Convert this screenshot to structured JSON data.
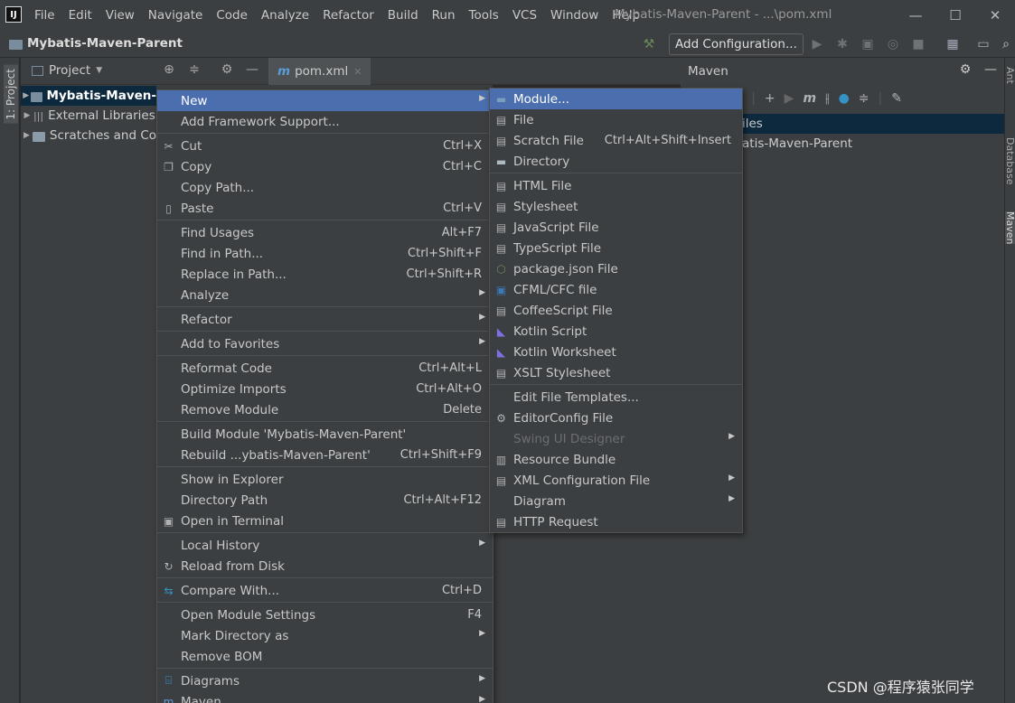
{
  "app": {
    "logo": "IJ",
    "window_title": "Mybatis-Maven-Parent - ...\\pom.xml",
    "window_controls": [
      "—",
      "☐",
      "✕"
    ]
  },
  "menubar": [
    "File",
    "Edit",
    "View",
    "Navigate",
    "Code",
    "Analyze",
    "Refactor",
    "Build",
    "Run",
    "Tools",
    "VCS",
    "Window",
    "Help"
  ],
  "navbar": {
    "project": "Mybatis-Maven-Parent",
    "add_configuration": "Add Configuration..."
  },
  "left_stripe": {
    "label": "1: Project"
  },
  "project_panel": {
    "title": "Project",
    "tab": "pom.xml",
    "tab_icon": "m",
    "tree": [
      {
        "label": "Mybatis-Maven-",
        "selected": true
      },
      {
        "label": "External Libraries",
        "selected": false
      },
      {
        "label": "Scratches and Co",
        "selected": false
      }
    ]
  },
  "maven_panel": {
    "title": "Maven",
    "rows": [
      "iles",
      "atis-Maven-Parent"
    ]
  },
  "right_stripe": [
    "Ant",
    "Database",
    "Maven"
  ],
  "context_menu": {
    "groups": [
      [
        {
          "label": "New",
          "shortcut": "",
          "submenu": true,
          "highlighted": true,
          "icon": ""
        },
        {
          "label": "Add Framework Support...",
          "shortcut": "",
          "submenu": false,
          "icon": ""
        }
      ],
      [
        {
          "label": "Cut",
          "shortcut": "Ctrl+X",
          "icon": "scissors-icon"
        },
        {
          "label": "Copy",
          "shortcut": "Ctrl+C",
          "icon": "copy-icon"
        },
        {
          "label": "Copy Path...",
          "shortcut": "",
          "icon": ""
        },
        {
          "label": "Paste",
          "shortcut": "Ctrl+V",
          "icon": "paste-icon"
        }
      ],
      [
        {
          "label": "Find Usages",
          "shortcut": "Alt+F7",
          "icon": ""
        },
        {
          "label": "Find in Path...",
          "shortcut": "Ctrl+Shift+F",
          "icon": ""
        },
        {
          "label": "Replace in Path...",
          "shortcut": "Ctrl+Shift+R",
          "icon": ""
        },
        {
          "label": "Analyze",
          "shortcut": "",
          "submenu": true,
          "icon": ""
        }
      ],
      [
        {
          "label": "Refactor",
          "shortcut": "",
          "submenu": true,
          "icon": ""
        }
      ],
      [
        {
          "label": "Add to Favorites",
          "shortcut": "",
          "submenu": true,
          "icon": ""
        }
      ],
      [
        {
          "label": "Reformat Code",
          "shortcut": "Ctrl+Alt+L",
          "icon": ""
        },
        {
          "label": "Optimize Imports",
          "shortcut": "Ctrl+Alt+O",
          "icon": ""
        },
        {
          "label": "Remove Module",
          "shortcut": "Delete",
          "icon": ""
        }
      ],
      [
        {
          "label": "Build Module 'Mybatis-Maven-Parent'",
          "shortcut": "",
          "icon": ""
        },
        {
          "label": "Rebuild ...ybatis-Maven-Parent'",
          "shortcut": "Ctrl+Shift+F9",
          "icon": ""
        }
      ],
      [
        {
          "label": "Show in Explorer",
          "shortcut": "",
          "icon": ""
        },
        {
          "label": "Directory Path",
          "shortcut": "Ctrl+Alt+F12",
          "icon": ""
        },
        {
          "label": "Open in Terminal",
          "shortcut": "",
          "icon": "terminal-icon"
        }
      ],
      [
        {
          "label": "Local History",
          "shortcut": "",
          "submenu": true,
          "icon": ""
        },
        {
          "label": "Reload from Disk",
          "shortcut": "",
          "icon": "reload-icon"
        }
      ],
      [
        {
          "label": "Compare With...",
          "shortcut": "Ctrl+D",
          "icon": "compare-icon"
        }
      ],
      [
        {
          "label": "Open Module Settings",
          "shortcut": "F4",
          "icon": ""
        },
        {
          "label": "Mark Directory as",
          "shortcut": "",
          "submenu": true,
          "icon": ""
        },
        {
          "label": "Remove BOM",
          "shortcut": "",
          "icon": ""
        }
      ],
      [
        {
          "label": "Diagrams",
          "shortcut": "",
          "submenu": true,
          "icon": "diagram-icon"
        },
        {
          "label": "Maven",
          "shortcut": "",
          "submenu": true,
          "icon": "maven-icon"
        }
      ]
    ]
  },
  "new_submenu": {
    "groups": [
      [
        {
          "label": "Module...",
          "shortcut": "",
          "icon": "module-icon",
          "highlighted": true
        },
        {
          "label": "File",
          "shortcut": "",
          "icon": "file-icon"
        },
        {
          "label": "Scratch File",
          "shortcut": "Ctrl+Alt+Shift+Insert",
          "icon": "scratch-file-icon"
        },
        {
          "label": "Directory",
          "shortcut": "",
          "icon": "directory-icon"
        }
      ],
      [
        {
          "label": "HTML File",
          "shortcut": "",
          "icon": "html-file-icon"
        },
        {
          "label": "Stylesheet",
          "shortcut": "",
          "icon": "stylesheet-icon"
        },
        {
          "label": "JavaScript File",
          "shortcut": "",
          "icon": "javascript-file-icon"
        },
        {
          "label": "TypeScript File",
          "shortcut": "",
          "icon": "typescript-file-icon"
        },
        {
          "label": "package.json File",
          "shortcut": "",
          "icon": "package-json-icon"
        },
        {
          "label": "CFML/CFC file",
          "shortcut": "",
          "icon": "cfml-icon"
        },
        {
          "label": "CoffeeScript File",
          "shortcut": "",
          "icon": "coffeescript-icon"
        },
        {
          "label": "Kotlin Script",
          "shortcut": "",
          "icon": "kotlin-script-icon"
        },
        {
          "label": "Kotlin Worksheet",
          "shortcut": "",
          "icon": "kotlin-worksheet-icon"
        },
        {
          "label": "XSLT Stylesheet",
          "shortcut": "",
          "icon": "xslt-icon"
        }
      ],
      [
        {
          "label": "Edit File Templates...",
          "shortcut": "",
          "icon": ""
        },
        {
          "label": "EditorConfig File",
          "shortcut": "",
          "icon": "gear-icon"
        },
        {
          "label": "Swing UI Designer",
          "shortcut": "",
          "icon": "",
          "submenu": true,
          "disabled": true
        },
        {
          "label": "Resource Bundle",
          "shortcut": "",
          "icon": "resource-bundle-icon"
        },
        {
          "label": "XML Configuration File",
          "shortcut": "",
          "icon": "xml-config-icon",
          "submenu": true
        },
        {
          "label": "Diagram",
          "shortcut": "",
          "icon": "",
          "submenu": true
        },
        {
          "label": "HTTP Request",
          "shortcut": "",
          "icon": "http-request-icon"
        }
      ]
    ]
  },
  "watermark": "CSDN @程序猿张同学",
  "colors": {
    "highlight": "#4b6eaf",
    "panel": "#3c3f41",
    "editor": "#2b2b2b",
    "tree_selection": "#0d293e"
  }
}
